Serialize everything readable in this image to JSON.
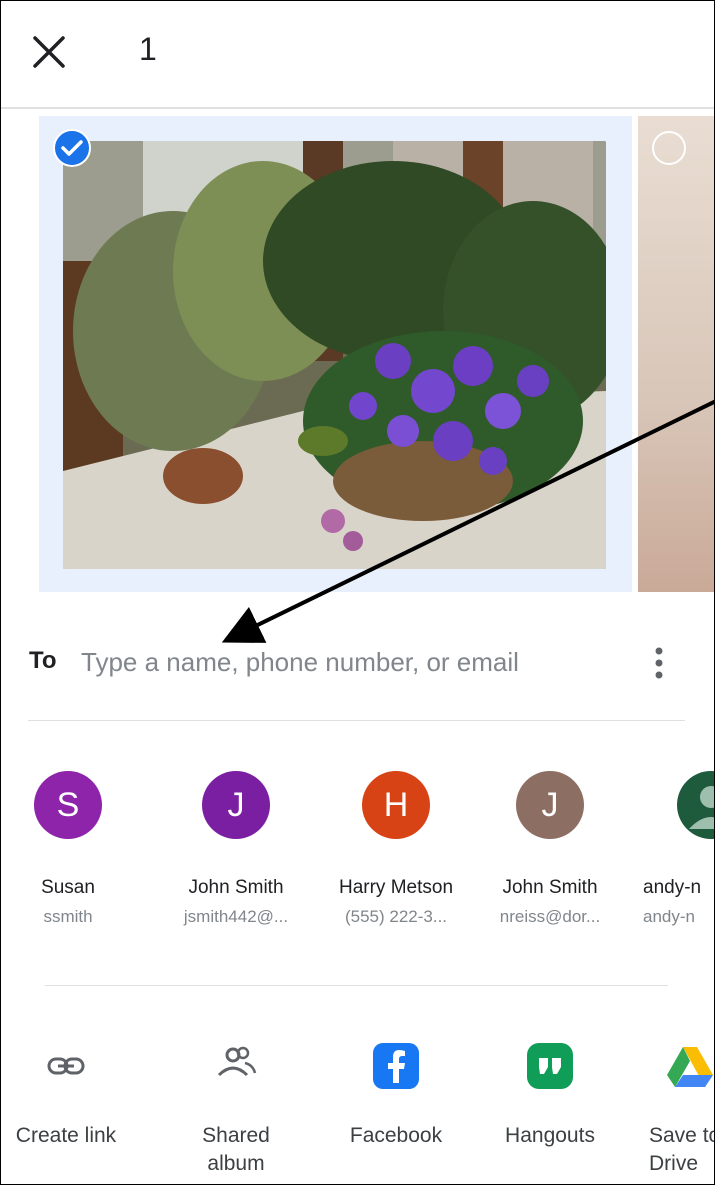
{
  "header": {
    "count": "1"
  },
  "share": {
    "to_label": "To",
    "placeholder": "Type a name, phone number, or email"
  },
  "contacts": [
    {
      "initial": "S",
      "name": "Susan",
      "sub": "ssmith",
      "color": "#8e24aa"
    },
    {
      "initial": "J",
      "name": "John Smith",
      "sub": "jsmith442@...",
      "color": "#7b1fa2"
    },
    {
      "initial": "H",
      "name": "Harry Metson",
      "sub": "(555) 222-3...",
      "color": "#d84315"
    },
    {
      "initial": "J",
      "name": "John Smith",
      "sub": "nreiss@dor...",
      "color": "#8d6e63"
    },
    {
      "initial": "",
      "name": "andy-n",
      "sub": "andy-n",
      "color": "#1e5a3c"
    }
  ],
  "apps": [
    {
      "label": "Create link",
      "icon": "link-icon"
    },
    {
      "label": "Shared album",
      "icon": "shared-album-icon"
    },
    {
      "label": "Facebook",
      "icon": "facebook-icon",
      "color": "#1877f2"
    },
    {
      "label": "Hangouts",
      "icon": "hangouts-icon",
      "color": "#0f9d58"
    },
    {
      "label": "Save to Drive",
      "icon": "drive-icon"
    }
  ]
}
